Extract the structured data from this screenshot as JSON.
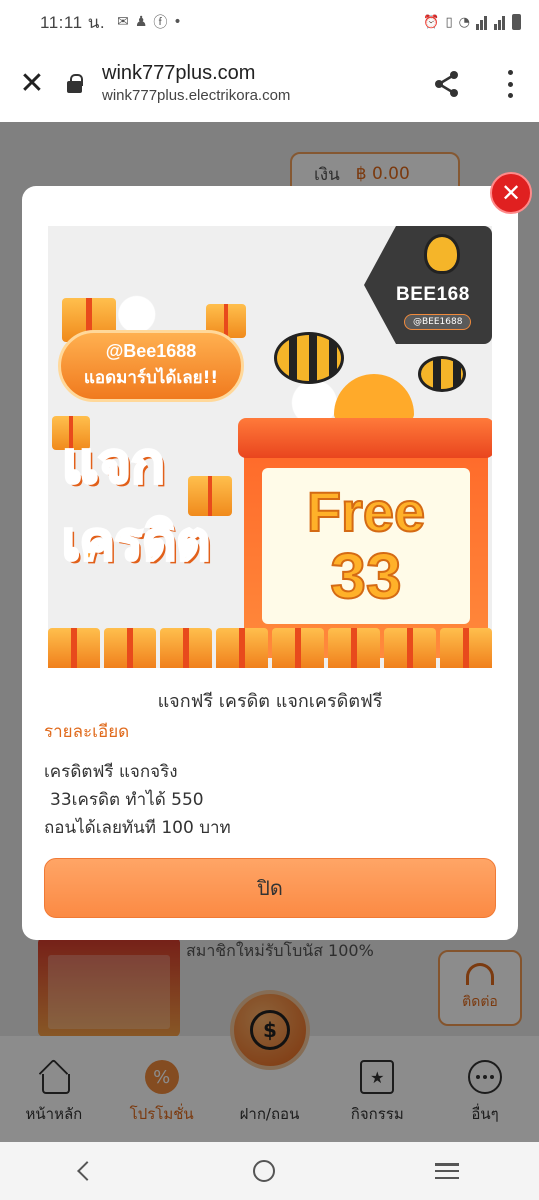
{
  "status_bar": {
    "time": "11:11 น."
  },
  "browser": {
    "title": "wink777plus.com",
    "subtitle": "wink777plus.electrikora.com"
  },
  "background_page": {
    "balance_label": "เงิน",
    "balance_amount": "฿ 0.00",
    "promo_text": "สมาชิกใหม่รับโบนัส 100%",
    "contact_label": "ติดต่อ"
  },
  "modal": {
    "banner": {
      "handle_pill": "@Bee1688",
      "pill_text": "แอดมาร์บได้เลย!!",
      "logo": "BEE168",
      "logo_handle": "@BEE1688",
      "headline_1": "แจก",
      "headline_2": "เครดิต",
      "free_word": "Free",
      "free_amount": "33"
    },
    "title": "แจกฟรี เครดิต แจกเครดิตฟรี",
    "details_label": "รายละเอียด",
    "description": [
      "เครดิตฟรี แจกจริง",
      "33เครดิต ทำได้ 550",
      "ถอนได้เลยทันที 100 บาท"
    ],
    "close_button": "ปิด"
  },
  "bottom_nav": {
    "items": [
      {
        "label": "หน้าหลัก"
      },
      {
        "label": "โปรโมชั่น"
      },
      {
        "label": "ฝาก/ถอน"
      },
      {
        "label": "กิจกรรม"
      },
      {
        "label": "อื่นๆ"
      }
    ]
  },
  "colors": {
    "accent": "#e06a1c",
    "button": "#fb8a44",
    "close_red": "#e02020"
  }
}
